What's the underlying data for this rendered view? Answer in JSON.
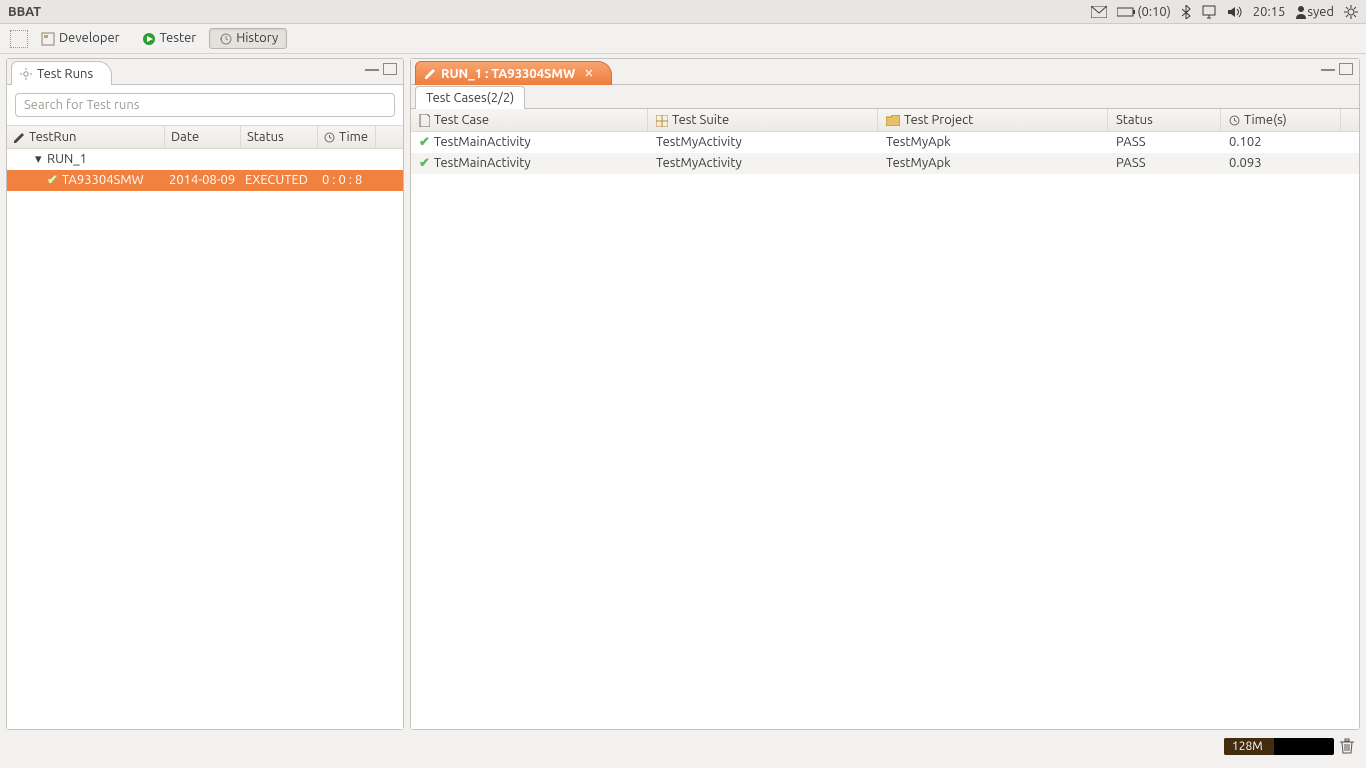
{
  "system": {
    "app_title": "BBAT",
    "battery": "(0:10)",
    "clock": "20:15",
    "user": "syed"
  },
  "perspectives": {
    "developer": "Developer",
    "tester": "Tester",
    "history": "History"
  },
  "left_pane": {
    "tab_title": "Test Runs",
    "search_placeholder": "Search for Test runs",
    "columns": {
      "c1": "TestRun",
      "c2": "Date",
      "c3": "Status",
      "c4": "Time"
    },
    "tree": {
      "root_name": "RUN_1",
      "child": {
        "name": "TA93304SMW",
        "date": "2014-08-09",
        "status": "EXECUTED",
        "time": "0 : 0 : 8"
      }
    }
  },
  "right_pane": {
    "tab_title": "RUN_1 : TA93304SMW",
    "subtab": "Test Cases(2/2)",
    "columns": {
      "c1": "Test Case",
      "c2": "Test Suite",
      "c3": "Test Project",
      "c4": "Status",
      "c5": "Time(s)"
    },
    "rows": [
      {
        "case": "TestMainActivity",
        "suite": "TestMyActivity",
        "project": "TestMyApk",
        "status": "PASS",
        "time": "0.102"
      },
      {
        "case": "TestMainActivity",
        "suite": "TestMyActivity",
        "project": "TestMyApk",
        "status": "PASS",
        "time": "0.093"
      }
    ]
  },
  "footer": {
    "heap": "128M"
  }
}
